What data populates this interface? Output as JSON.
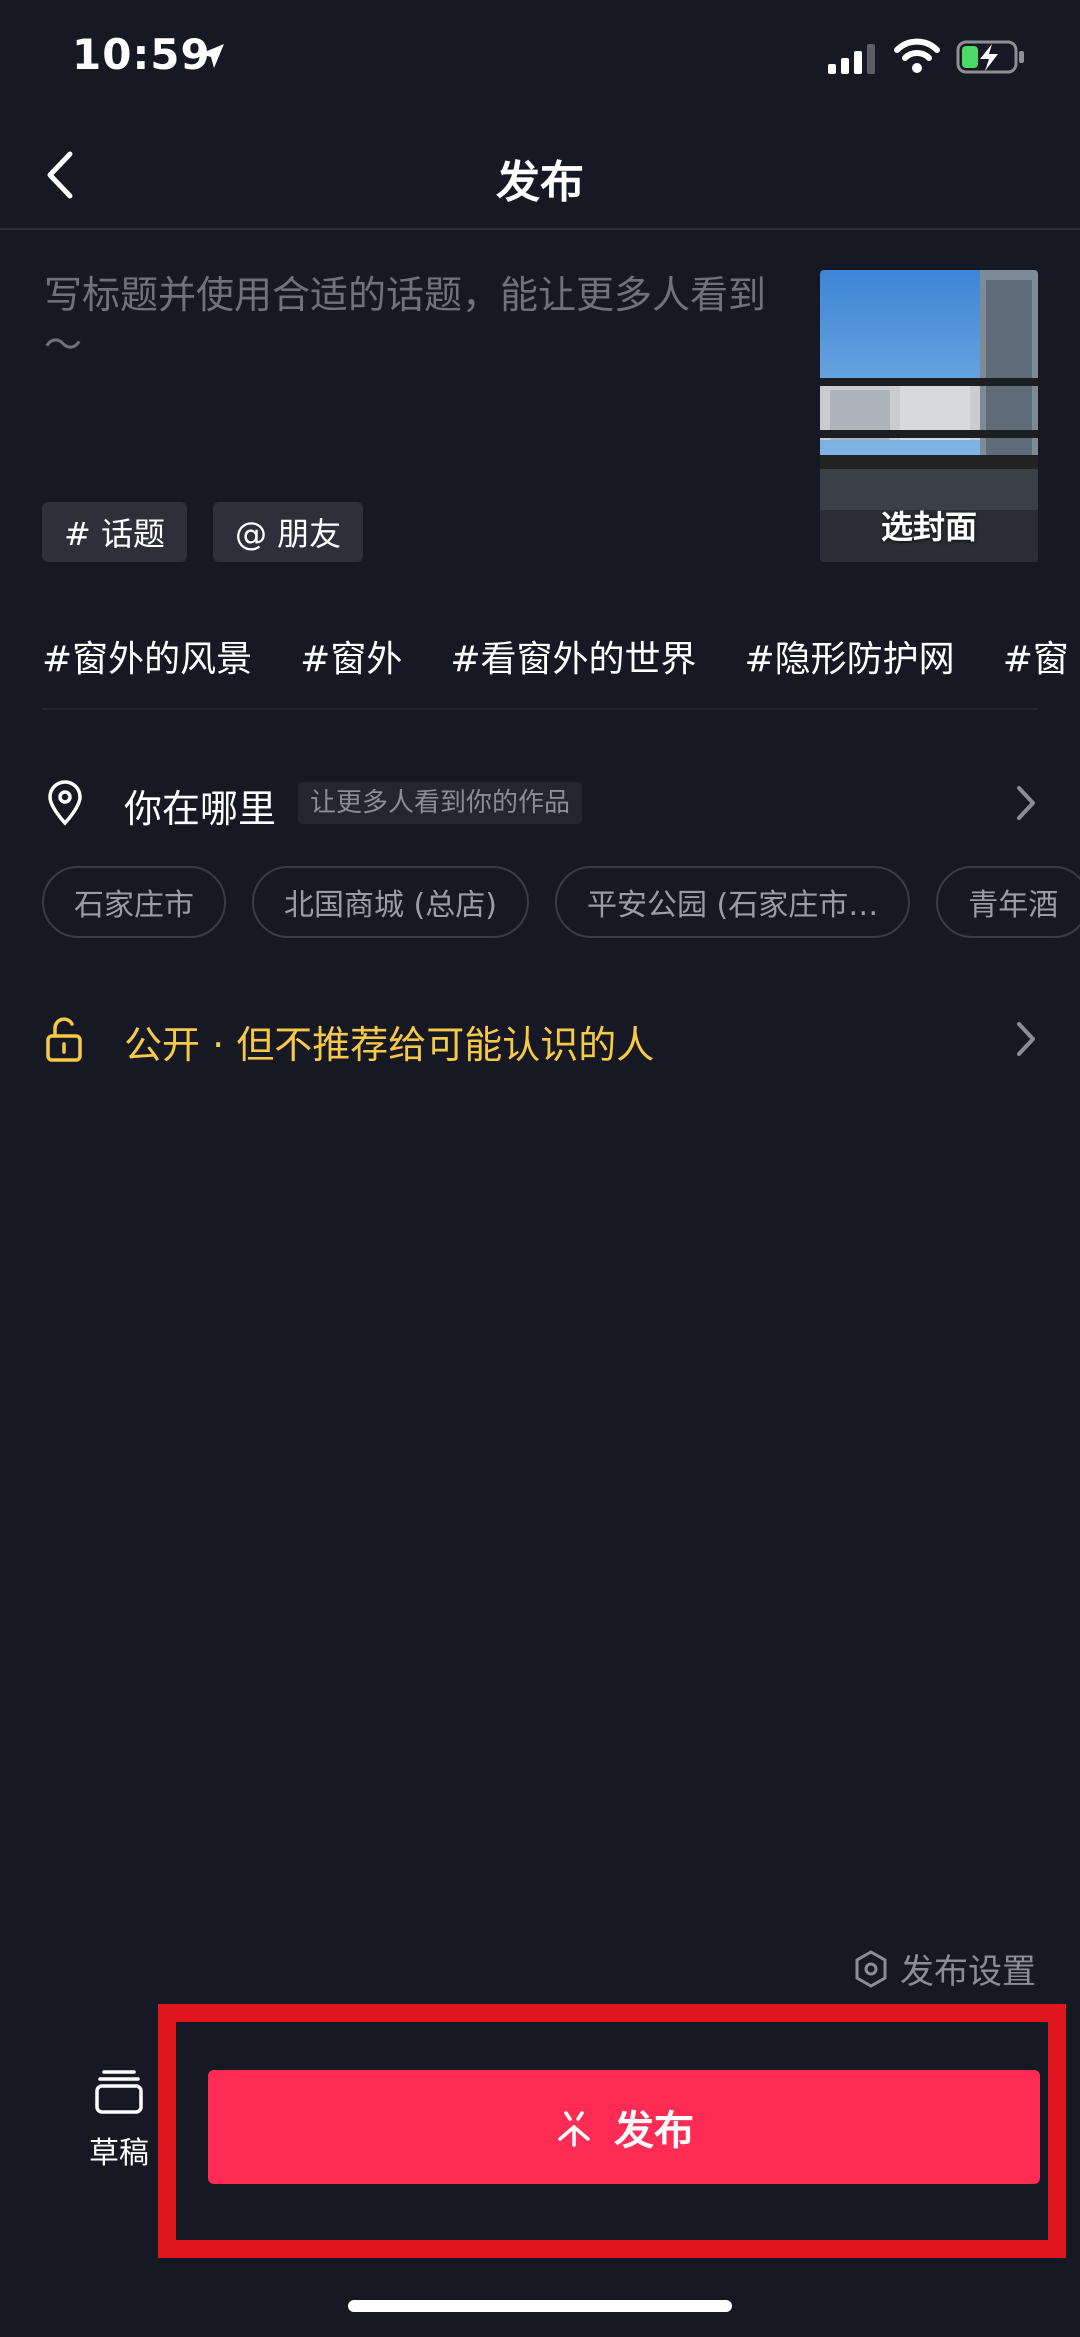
{
  "status_bar": {
    "time": "10:59"
  },
  "nav": {
    "title": "发布"
  },
  "caption": {
    "placeholder": "写标题并使用合适的话题，能让更多人看到～",
    "value": ""
  },
  "cover": {
    "label": "选封面"
  },
  "chips": {
    "topic": "# 话题",
    "friends": "@ 朋友"
  },
  "topics": [
    "#窗外的风景",
    "#窗外",
    "#看窗外的世界",
    "#隐形防护网",
    "#窗"
  ],
  "location": {
    "title": "你在哪里",
    "hint": "让更多人看到你的作品",
    "places": [
      "石家庄市",
      "北国商城 (总店)",
      "平安公园 (石家庄市…",
      "青年酒"
    ]
  },
  "privacy": {
    "text": "公开 · 但不推荐给可能认识的人"
  },
  "settings": {
    "label": "发布设置"
  },
  "bottom": {
    "draft_label": "草稿",
    "publish_label": "发布"
  },
  "colors": {
    "accent": "#fe2c55",
    "background": "#161823",
    "privacy": "#f7c948",
    "highlight": "#e0161e"
  }
}
